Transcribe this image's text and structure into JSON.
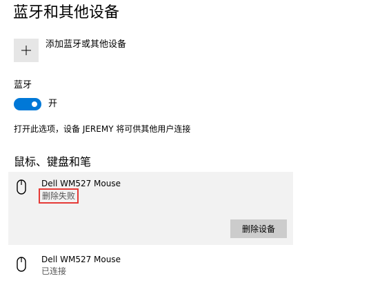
{
  "page": {
    "title": "蓝牙和其他设备"
  },
  "add_device": {
    "label": "添加蓝牙或其他设备",
    "icon": "plus-icon"
  },
  "bluetooth": {
    "heading": "蓝牙",
    "toggle_state": "on",
    "toggle_label": "开",
    "toggle_color": "#0078d7",
    "discoverable_note": "打开此选项，设备 JEREMY 将可供其他用户连接"
  },
  "mouse_section": {
    "heading": "鼠标、键盘和笔",
    "devices": [
      {
        "name": "Dell WM527 Mouse",
        "status": "删除失败",
        "icon": "mouse-icon",
        "selected": true,
        "action_label": "删除设备"
      },
      {
        "name": "Dell WM527 Mouse",
        "status": "已连接",
        "icon": "mouse-icon",
        "selected": false
      }
    ]
  },
  "colors": {
    "accent": "#0078d7",
    "error_highlight": "#e53935",
    "selected_background": "#f2f2f2"
  }
}
